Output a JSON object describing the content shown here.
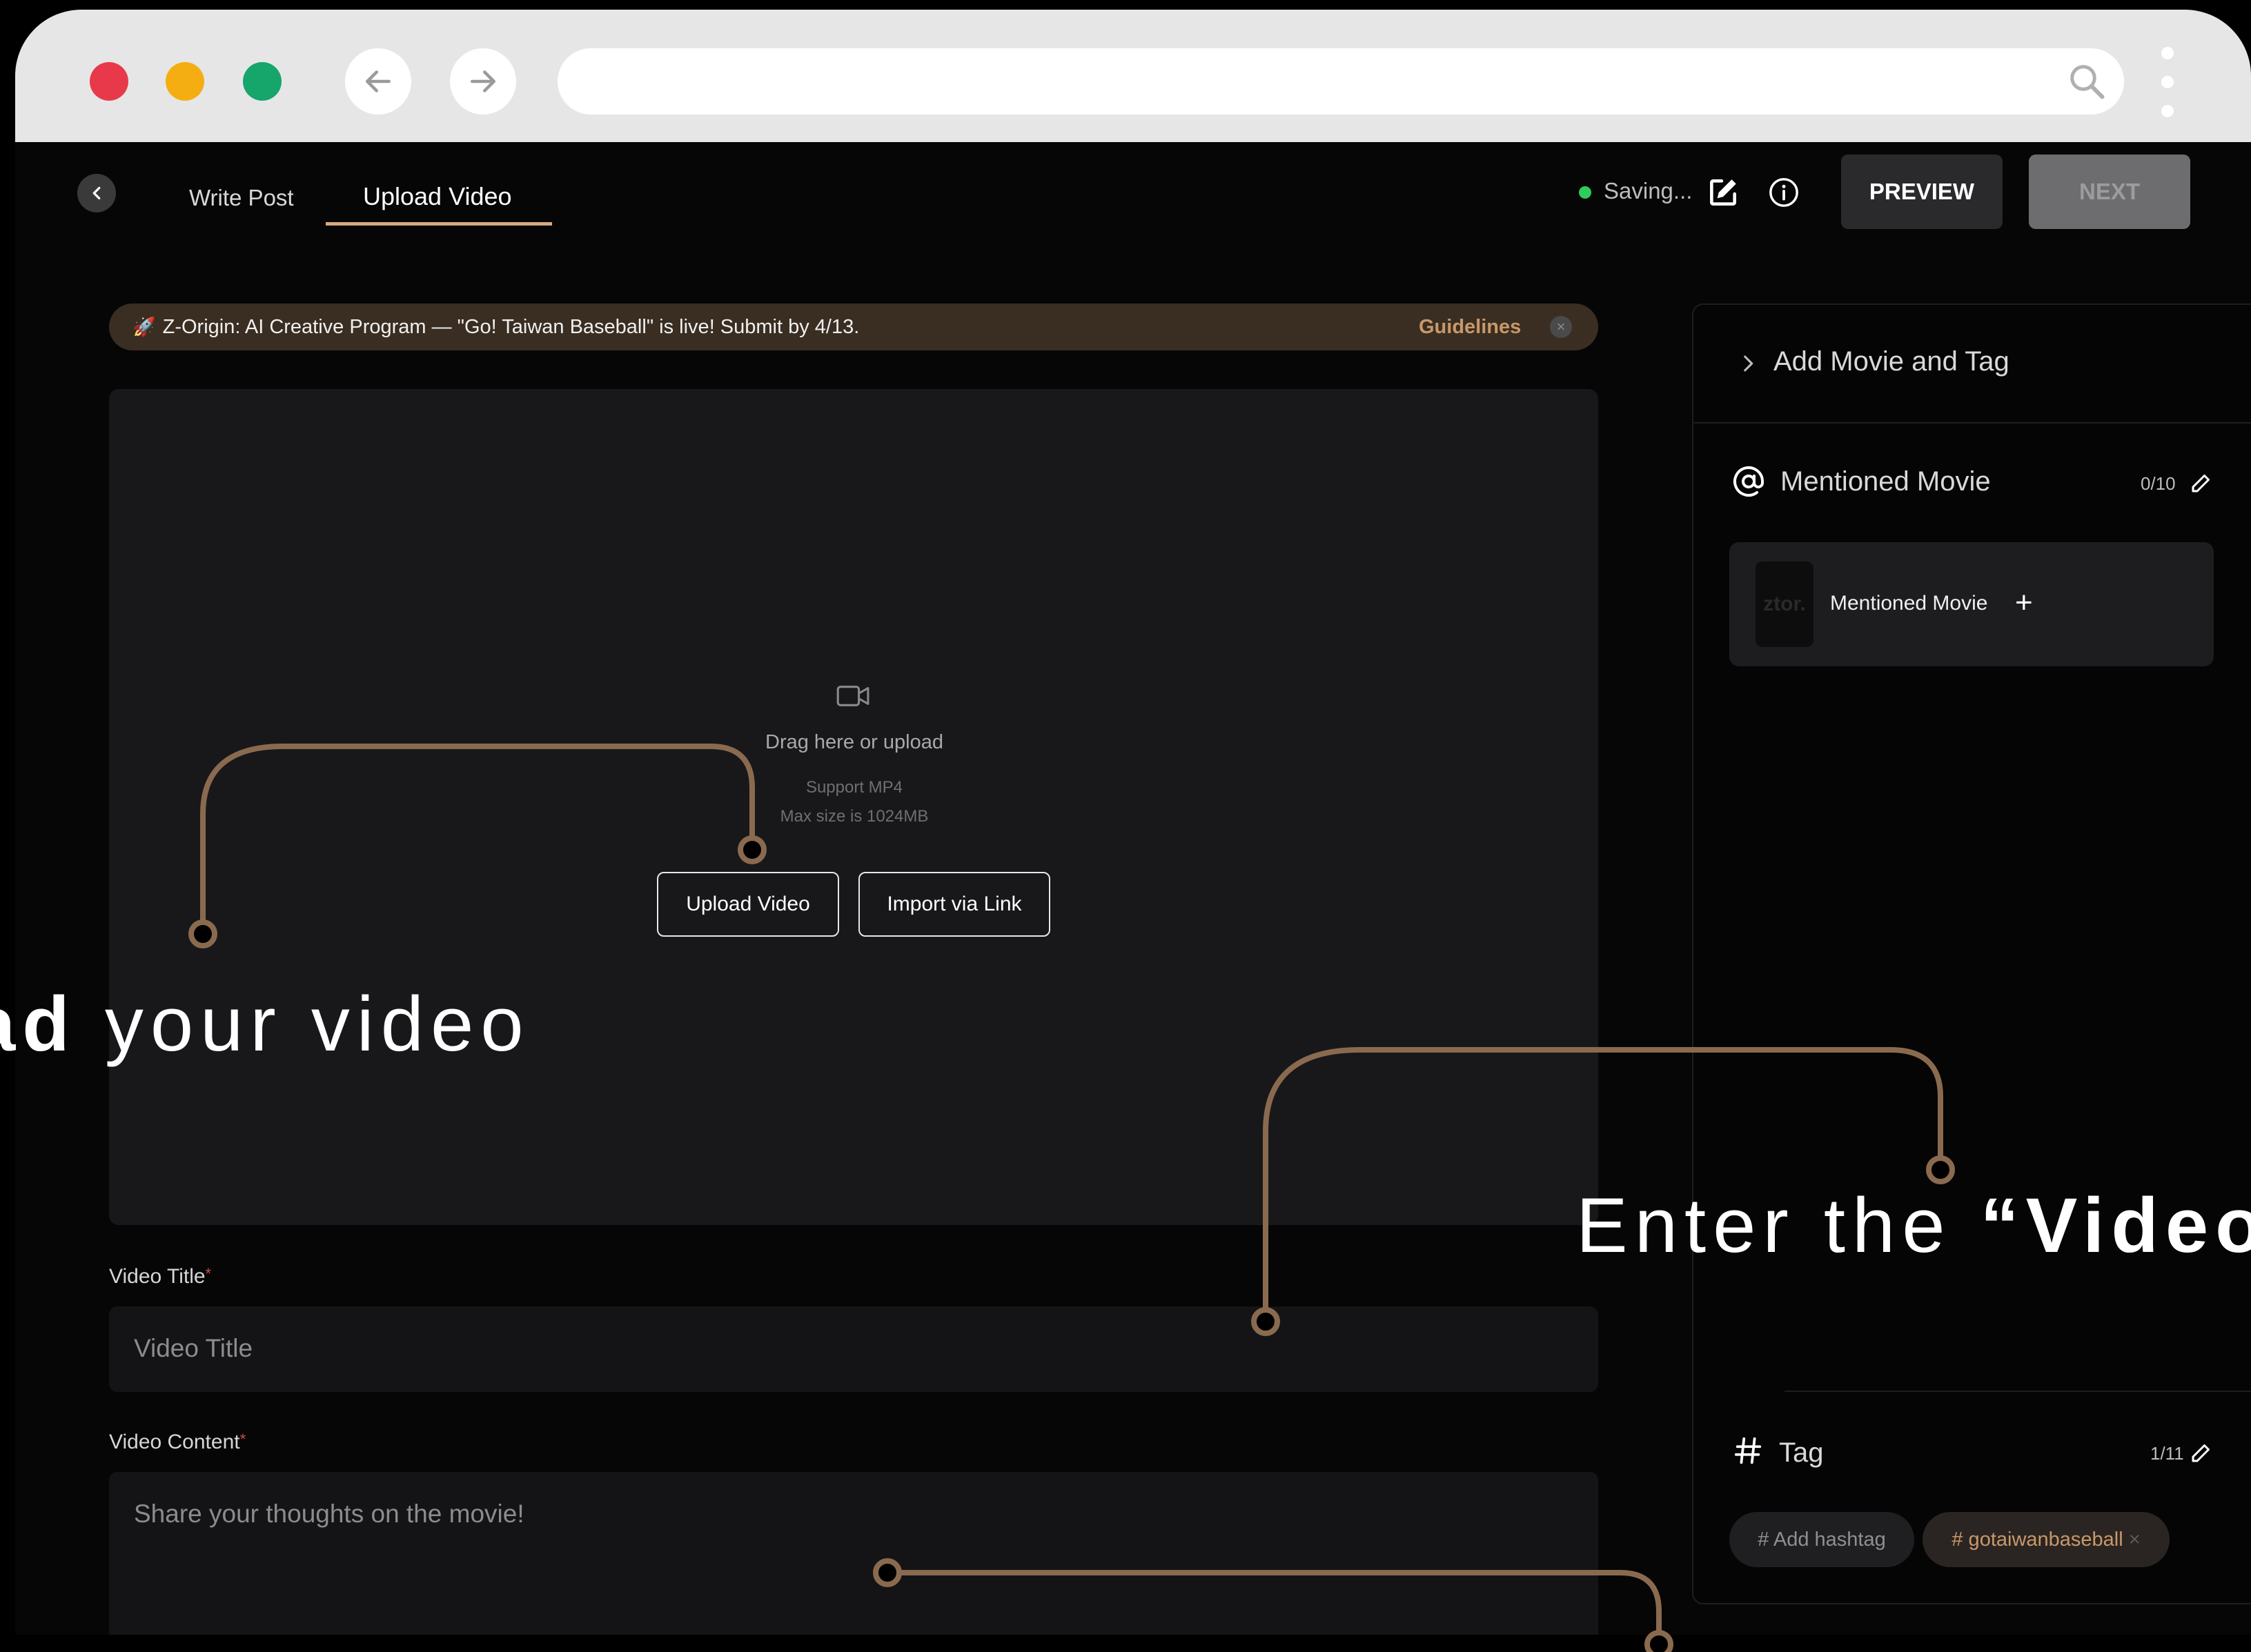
{
  "browser": {
    "window_buttons": [
      "close",
      "minimize",
      "maximize"
    ],
    "colors": {
      "close": "#e8394a",
      "minimize": "#f5ae11",
      "maximize": "#16a56b"
    }
  },
  "header": {
    "tabs": [
      {
        "label": "Write Post",
        "active": false
      },
      {
        "label": "Upload Video",
        "active": true
      }
    ],
    "saving_text": "Saving...",
    "preview_label": "PREVIEW",
    "next_label": "NEXT"
  },
  "banner": {
    "emoji": "🚀",
    "text": "Z-Origin: AI Creative Program — \"Go! Taiwan Baseball\" is live! Submit by 4/13.",
    "link": "Guidelines",
    "close": "×"
  },
  "upload": {
    "drag_text": "Drag here or upload",
    "support_text": "Support MP4",
    "max_size_text": "Max size is 1024MB",
    "upload_button": "Upload Video",
    "import_button": "Import via Link"
  },
  "form": {
    "title_label": "Video Title",
    "title_placeholder": "Video Title",
    "content_label": "Video Content",
    "content_placeholder": "Share your thoughts on the movie!",
    "required_mark": "*"
  },
  "side_panel": {
    "add_movie_title": "Add Movie and Tag",
    "mentioned_title": "Mentioned Movie",
    "mentioned_count": "0/10",
    "movie_card_label": "Mentioned Movie",
    "movie_thumb_text": "ztor.",
    "plus": "+",
    "tag_title": "Tag",
    "tag_count": "1/11",
    "chips": [
      "# Add hashtag",
      "# gotaiwanbaseball"
    ],
    "chip_close": "×"
  },
  "annotations": {
    "upload_bold": "ad",
    "upload_rest": " your video",
    "enter_rest": "Enter the ",
    "enter_bold": "“Video"
  },
  "colors": {
    "accent": "#c9986a",
    "connector": "#8a6a4f",
    "saving_dot": "#2ecc5a",
    "banner_bg": "#3a2e22"
  }
}
